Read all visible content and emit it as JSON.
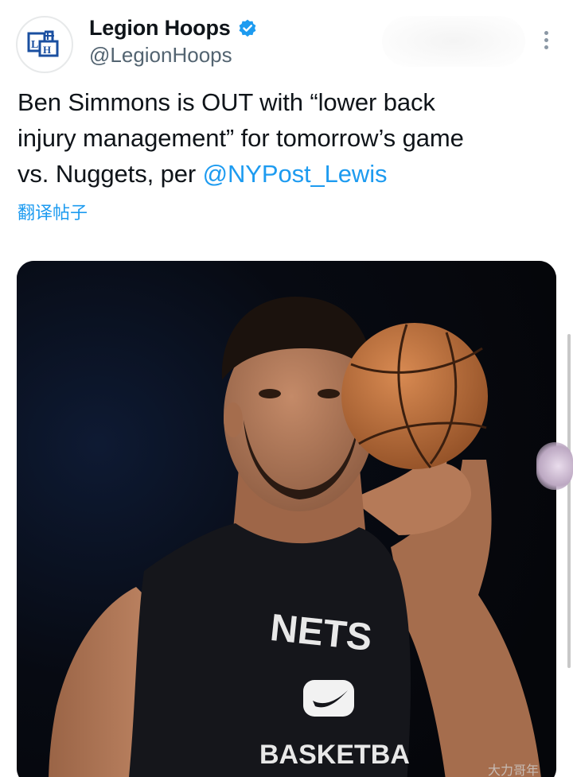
{
  "account": {
    "display_name": "Legion Hoops",
    "handle": "@LegionHoops",
    "avatar_icon": "legion-hoops-logo-icon",
    "verified_icon": "verified-badge-icon"
  },
  "tweet": {
    "text_line1": "Ben Simmons is OUT with “lower back",
    "text_line2": "injury management” for tomorrow’s game",
    "text_line3_prefix": "vs. Nuggets, per ",
    "mention": "@NYPost_Lewis",
    "translate_label": "翻译帖子"
  },
  "media": {
    "description_icon": "player-photo",
    "jersey_team": "NETS",
    "jersey_bottom": "BASKETBA",
    "watermark": "大力哥年"
  },
  "more_icon": "more-options-icon",
  "colors": {
    "link": "#1d9bf0",
    "text": "#0f1419",
    "secondary": "#536471",
    "verified": "#1d9bf0"
  }
}
